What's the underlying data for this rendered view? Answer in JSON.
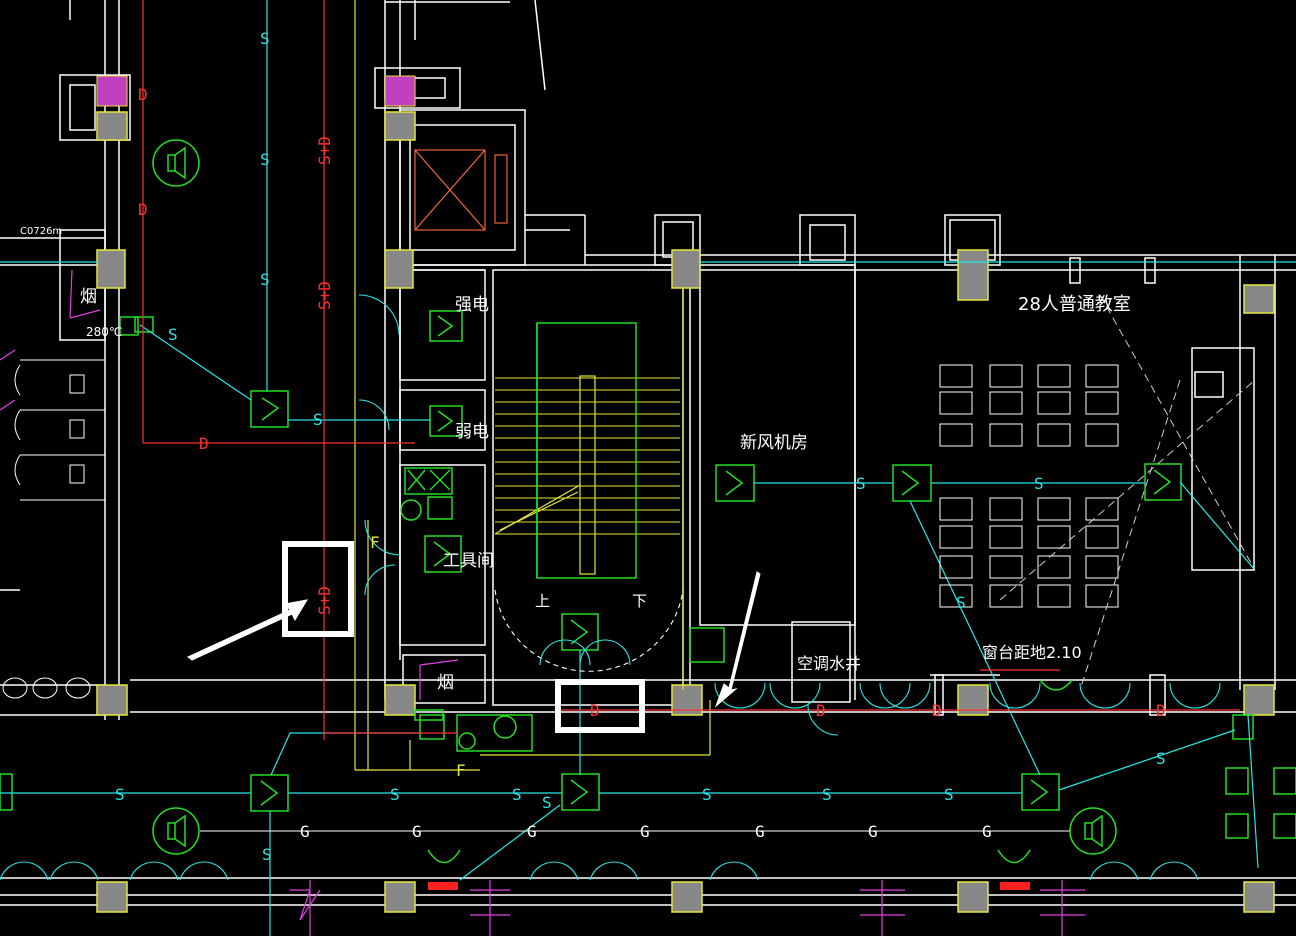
{
  "drawing": {
    "room_labels": {
      "strong_current": "强电",
      "weak_current": "弱电",
      "tool_room": "工具间",
      "smoke_shaft_right": "烟",
      "smoke_shaft_left": "烟",
      "fresh_air_room": "新风机房",
      "ac_water_shaft": "空调水井",
      "classroom": "28人普通教室",
      "window_sill": "窗台距地2.10",
      "stair_up": "上",
      "stair_down": "下"
    },
    "annotations": {
      "damper_temp": "280℃",
      "top_left_note": "C0726m"
    },
    "pipe_markers": {
      "supply": "S",
      "supply_drain": "S+D",
      "drain": "D",
      "gas": "G",
      "f_line": "F"
    },
    "highlight_boxes": [
      {
        "name": "vertical S+D label",
        "target": "S+D"
      },
      {
        "name": "horizontal D label",
        "target": "D"
      }
    ],
    "colors": {
      "background": "#000000",
      "wall": "#ffffff",
      "supply_line": "#27e7e7",
      "drain_line": "#ff3030",
      "equipment": "#22dd22",
      "yellow": "#e6e63c",
      "column_fill": "#888888",
      "magenta": "#e040e0"
    }
  }
}
